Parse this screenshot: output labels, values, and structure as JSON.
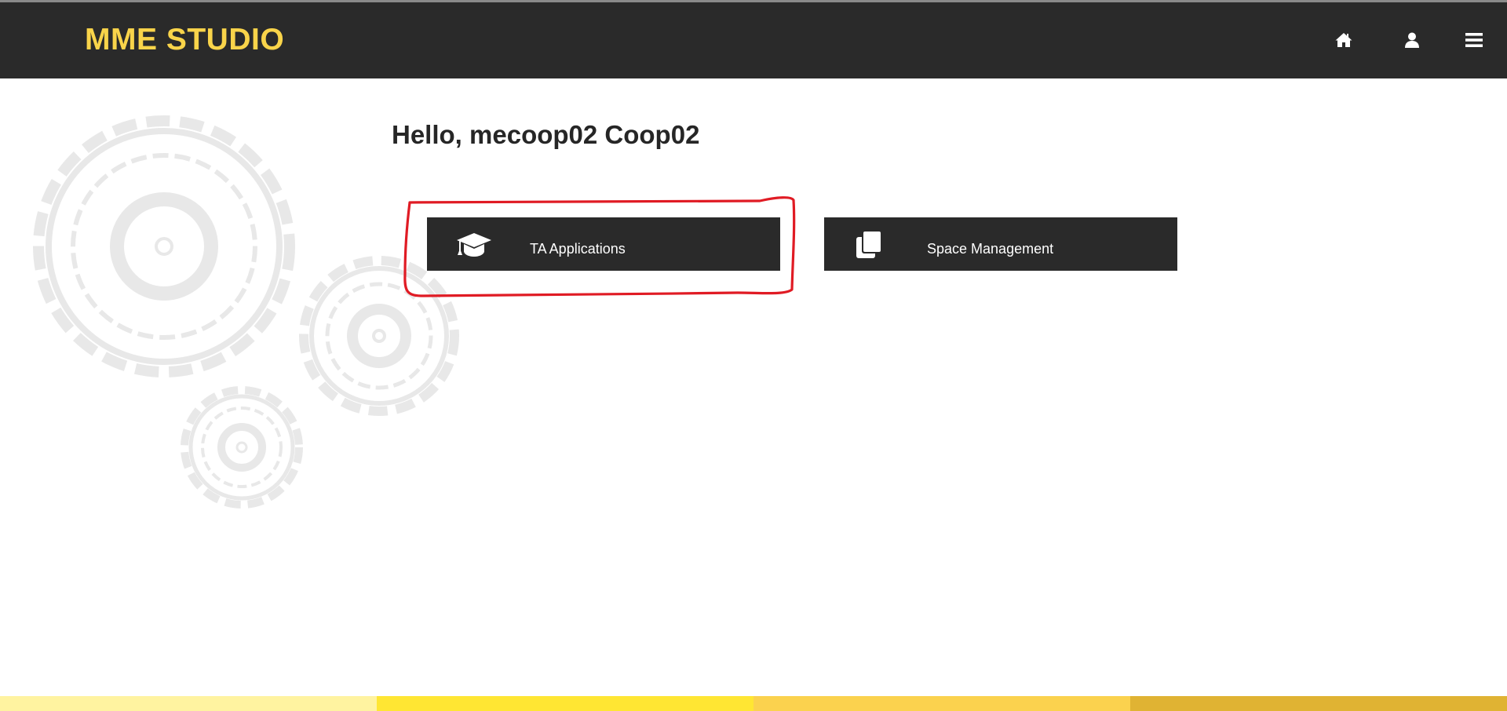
{
  "header": {
    "brand": "MME STUDIO",
    "icons": [
      "home-icon",
      "user-icon",
      "hamburger-menu-icon"
    ]
  },
  "main": {
    "greeting": "Hello, mecoop02 Coop02",
    "tiles": [
      {
        "label": "TA Applications",
        "icon": "graduation-cap-icon"
      },
      {
        "label": "Space Management",
        "icon": "copy-pages-icon"
      }
    ]
  },
  "colors": {
    "navbar": "#2a2a2a",
    "brand": "#f9d44a",
    "tile": "#2a2a2a",
    "annotation": "#e01b24",
    "footer": [
      "#fff3a0",
      "#ffe633",
      "#fbd24e",
      "#e0b333"
    ]
  }
}
